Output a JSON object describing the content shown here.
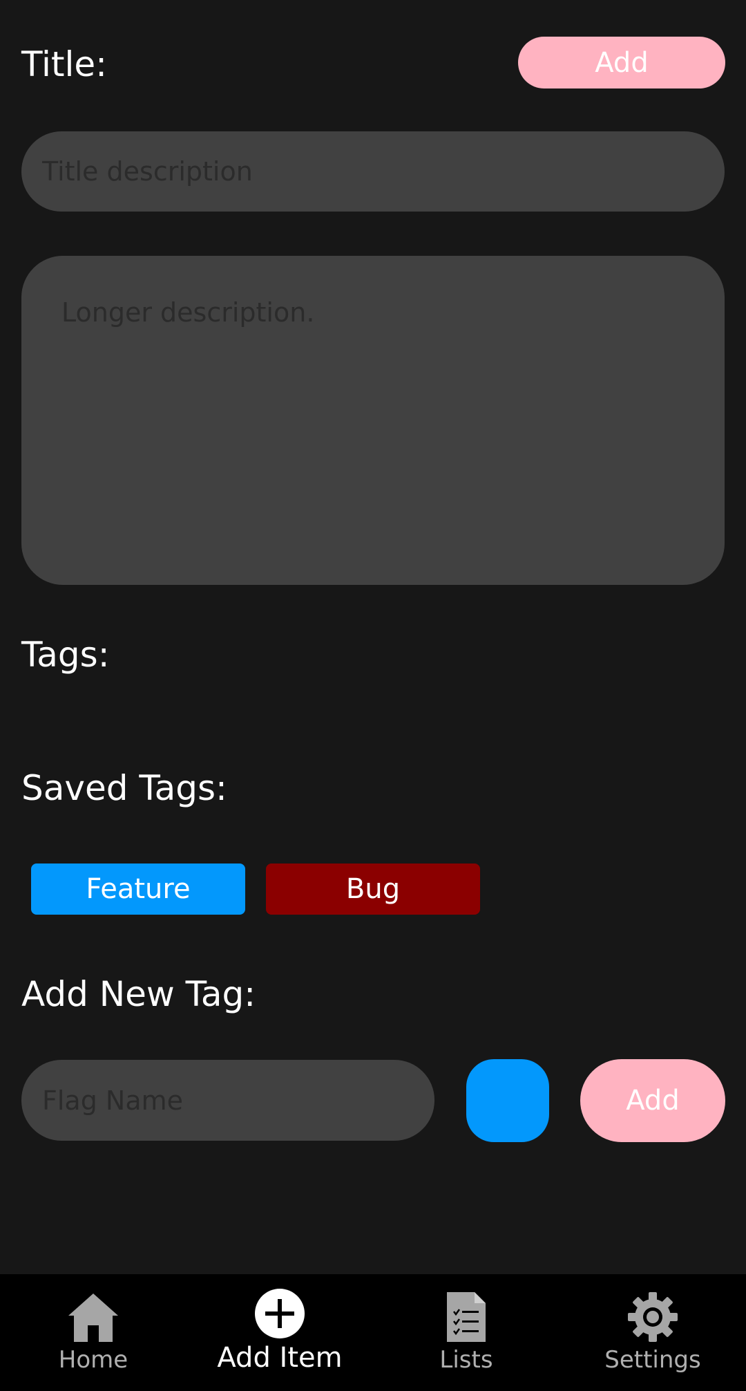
{
  "form": {
    "title_label": "Title:",
    "add_button_label": "Add",
    "title_placeholder": "Title description",
    "description_placeholder": "Longer description.",
    "tags_label": "Tags:",
    "saved_tags_label": "Saved Tags:",
    "saved_tags": [
      {
        "label": "Feature",
        "color": "#0398fc"
      },
      {
        "label": "Bug",
        "color": "#8b0000"
      }
    ],
    "add_new_tag_label": "Add New Tag:",
    "flag_name_placeholder": "Flag Name",
    "new_tag_color": "#0398fc",
    "add_tag_button_label": "Add"
  },
  "colors": {
    "background": "#171717",
    "field": "#414141",
    "accent_pink": "#ffb3c1",
    "nav_background": "#000000"
  },
  "nav": {
    "items": [
      {
        "label": "Home",
        "icon": "home-icon",
        "active": false
      },
      {
        "label": "Add Item",
        "icon": "add-circle-icon",
        "active": true
      },
      {
        "label": "Lists",
        "icon": "list-document-icon",
        "active": false
      },
      {
        "label": "Settings",
        "icon": "gear-icon",
        "active": false
      }
    ]
  }
}
